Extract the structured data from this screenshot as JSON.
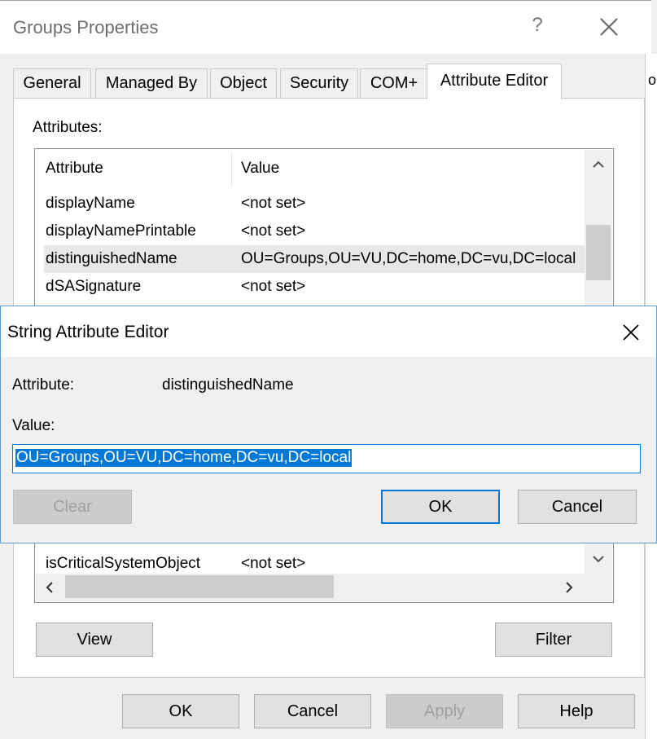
{
  "window": {
    "title": "Groups Properties",
    "help_glyph": "?",
    "right_edge_text": "o"
  },
  "tabs": [
    {
      "label": "General",
      "active": false
    },
    {
      "label": "Managed By",
      "active": false
    },
    {
      "label": "Object",
      "active": false
    },
    {
      "label": "Security",
      "active": false
    },
    {
      "label": "COM+",
      "active": false
    },
    {
      "label": "Attribute Editor",
      "active": true
    }
  ],
  "attributes_label": "Attributes:",
  "list": {
    "columns": [
      "Attribute",
      "Value"
    ],
    "rows": [
      {
        "attribute": "displayName",
        "value": "<not set>",
        "selected": false
      },
      {
        "attribute": "displayNamePrintable",
        "value": "<not set>",
        "selected": false
      },
      {
        "attribute": "distinguishedName",
        "value": "OU=Groups,OU=VU,DC=home,DC=vu,DC=local",
        "selected": true
      },
      {
        "attribute": "dSASignature",
        "value": "<not set>",
        "selected": false
      }
    ],
    "bottom_row": {
      "attribute": "isCriticalSystemObject",
      "value": "<not set>"
    }
  },
  "panel_buttons": {
    "view": "View",
    "filter": "Filter"
  },
  "footer_buttons": {
    "ok": "OK",
    "cancel": "Cancel",
    "apply": "Apply",
    "help": "Help"
  },
  "dialog": {
    "title": "String Attribute Editor",
    "attribute_label": "Attribute:",
    "attribute_value": "distinguishedName",
    "value_label": "Value:",
    "value_text": "OU=Groups,OU=VU,DC=home,DC=vu,DC=local",
    "clear": "Clear",
    "ok": "OK",
    "cancel": "Cancel"
  },
  "colors": {
    "accent": "#0078d7",
    "window_bg": "#f0f0f0",
    "selection": "#0078d7"
  },
  "icons": [
    "close-icon",
    "help-icon",
    "scroll-up-icon",
    "scroll-down-icon",
    "scroll-left-icon",
    "scroll-right-icon"
  ]
}
